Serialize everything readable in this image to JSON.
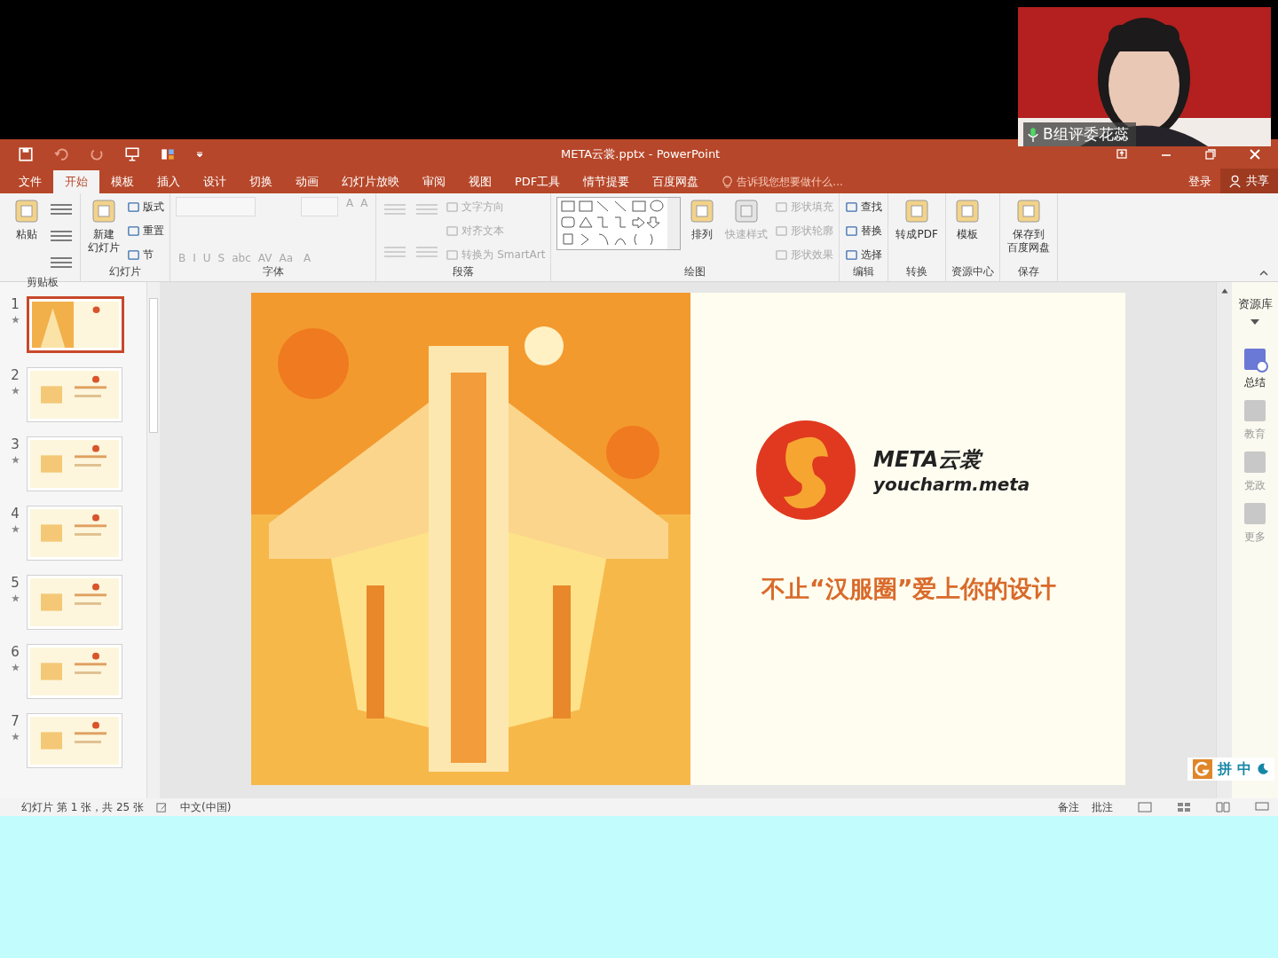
{
  "video": {
    "caption": "B组评委花蕊"
  },
  "titlebar": {
    "title": "META云裳.pptx - PowerPoint"
  },
  "tabs": [
    {
      "label": "文件",
      "selected": false
    },
    {
      "label": "开始",
      "selected": true
    },
    {
      "label": "模板",
      "selected": false
    },
    {
      "label": "插入",
      "selected": false
    },
    {
      "label": "设计",
      "selected": false
    },
    {
      "label": "切换",
      "selected": false
    },
    {
      "label": "动画",
      "selected": false
    },
    {
      "label": "幻灯片放映",
      "selected": false
    },
    {
      "label": "审阅",
      "selected": false
    },
    {
      "label": "视图",
      "selected": false
    },
    {
      "label": "PDF工具",
      "selected": false
    },
    {
      "label": "情节提要",
      "selected": false
    },
    {
      "label": "百度网盘",
      "selected": false
    }
  ],
  "search_hint": "告诉我您想要做什么...",
  "account": {
    "login": "登录",
    "share": "共享"
  },
  "ribbon": [
    {
      "label": "剪贴板",
      "columns": [
        [
          {
            "kind": "big",
            "lines": [
              "粘贴"
            ],
            "disabled": false
          }
        ],
        [
          {
            "kind": "icon",
            "disabled": false
          },
          {
            "kind": "icon",
            "disabled": false
          },
          {
            "kind": "icon",
            "disabled": false
          }
        ]
      ]
    },
    {
      "label": "幻灯片",
      "columns": [
        [
          {
            "kind": "big",
            "lines": [
              "新建",
              "幻灯片"
            ],
            "disabled": false
          }
        ],
        [
          {
            "kind": "small",
            "text": "版式",
            "disabled": false
          },
          {
            "kind": "small",
            "text": "重置",
            "disabled": false
          },
          {
            "kind": "small",
            "text": "节",
            "disabled": false
          }
        ]
      ]
    },
    {
      "label": "字体",
      "columns": [
        [
          {
            "kind": "field",
            "disabled": true
          },
          {
            "kind": "glyphs",
            "glyphs": [
              "B",
              "I",
              "U",
              "S",
              "abc",
              "AV",
              "Aa"
            ],
            "disabled": true
          }
        ],
        [
          {
            "kind": "field",
            "disabled": true
          },
          {
            "kind": "glyphs",
            "glyphs": [
              "A"
            ],
            "disabled": true
          }
        ],
        [
          {
            "kind": "glyphs",
            "glyphs": [
              "A",
              "A"
            ],
            "disabled": true
          }
        ]
      ]
    },
    {
      "label": "段落",
      "columns": [
        [
          {
            "kind": "icon",
            "disabled": true
          },
          {
            "kind": "icon",
            "disabled": true
          }
        ],
        [
          {
            "kind": "icon",
            "disabled": true
          },
          {
            "kind": "icon",
            "disabled": true
          }
        ],
        [
          {
            "kind": "small",
            "text": "文字方向",
            "disabled": true
          },
          {
            "kind": "small",
            "text": "对齐文本",
            "disabled": true
          },
          {
            "kind": "small",
            "text": "转换为 SmartArt",
            "disabled": true
          }
        ]
      ]
    },
    {
      "label": "绘图",
      "columns": [
        [
          {
            "kind": "gallery",
            "disabled": false
          }
        ],
        [
          {
            "kind": "big",
            "lines": [
              "排列"
            ],
            "disabled": false
          }
        ],
        [
          {
            "kind": "big",
            "lines": [
              "快速样式"
            ],
            "disabled": true
          }
        ],
        [
          {
            "kind": "small",
            "text": "形状填充",
            "disabled": true
          },
          {
            "kind": "small",
            "text": "形状轮廓",
            "disabled": true
          },
          {
            "kind": "small",
            "text": "形状效果",
            "disabled": true
          }
        ]
      ]
    },
    {
      "label": "编辑",
      "columns": [
        [
          {
            "kind": "small",
            "text": "查找",
            "disabled": false
          },
          {
            "kind": "small",
            "text": "替换",
            "disabled": false
          },
          {
            "kind": "small",
            "text": "选择",
            "disabled": false
          }
        ]
      ]
    },
    {
      "label": "转换",
      "columns": [
        [
          {
            "kind": "big",
            "lines": [
              "转成PDF"
            ],
            "disabled": false
          }
        ]
      ]
    },
    {
      "label": "资源中心",
      "columns": [
        [
          {
            "kind": "big",
            "lines": [
              "模板"
            ],
            "disabled": false
          }
        ]
      ]
    },
    {
      "label": "保存",
      "columns": [
        [
          {
            "kind": "big",
            "lines": [
              "保存到",
              "百度网盘"
            ],
            "disabled": false
          }
        ]
      ]
    }
  ],
  "thumbnails": [
    {
      "number": "1",
      "selected": true
    },
    {
      "number": "2",
      "selected": false
    },
    {
      "number": "3",
      "selected": false
    },
    {
      "number": "4",
      "selected": false
    },
    {
      "number": "5",
      "selected": false
    },
    {
      "number": "6",
      "selected": false
    },
    {
      "number": "7",
      "selected": false
    }
  ],
  "slide": {
    "brand": "META云裳",
    "url": "youcharm.meta",
    "tagline": "不止“汉服圈”爱上你的设计"
  },
  "side_pane": {
    "title": "资源库",
    "items": [
      {
        "label": "总结",
        "selected": true
      },
      {
        "label": "教育",
        "selected": false
      },
      {
        "label": "党政",
        "selected": false
      },
      {
        "label": "更多",
        "selected": false
      }
    ]
  },
  "ime": [
    "拼",
    "中"
  ],
  "status": {
    "slide_count": "幻灯片 第 1 张，共 25 张",
    "language": "中文(中国)",
    "notes": "备注",
    "comments": "批注"
  }
}
